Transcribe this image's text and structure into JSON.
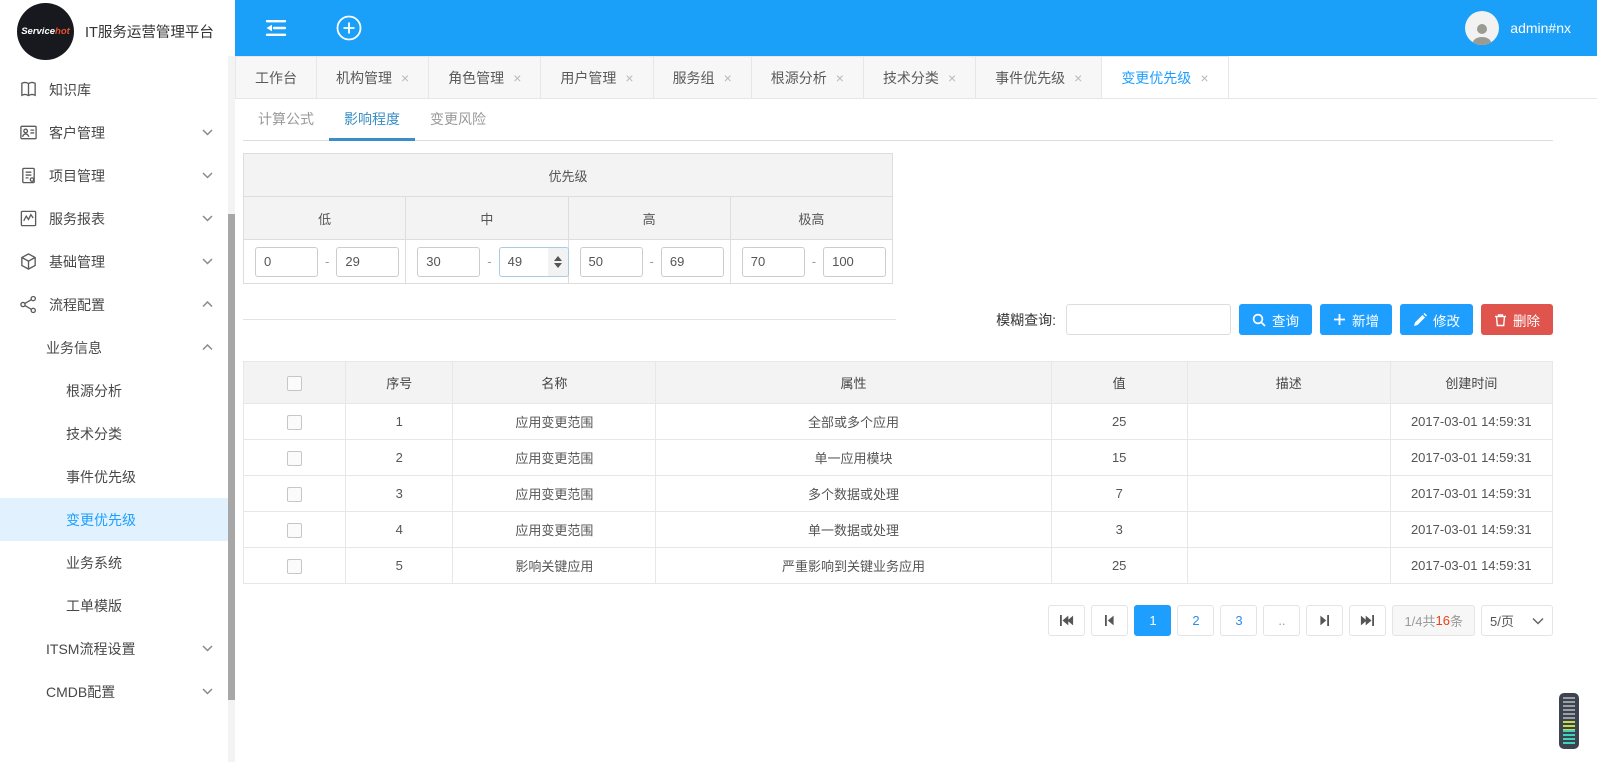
{
  "app": {
    "logo_part1": "Service",
    "logo_part2": "hot",
    "title": "IT服务运营管理平台",
    "username": "admin#nx"
  },
  "colors": {
    "header_blue": "#1aa0f8",
    "accent_blue": "#1E9FFF",
    "subtab_blue": "#3a8ec6",
    "danger_red": "#df544c",
    "count_red": "#ed3f14"
  },
  "icons": [
    "collapse-menu-icon",
    "plus-circle-icon",
    "book-icon",
    "customer-icon",
    "project-icon",
    "report-icon",
    "cube-icon",
    "share-icon",
    "chevron-down-icon",
    "chevron-up-icon",
    "search-icon",
    "plus-icon",
    "pencil-icon",
    "trash-icon",
    "first-page-icon",
    "prev-page-icon",
    "next-page-icon",
    "last-page-icon",
    "avatar"
  ],
  "sidebar": {
    "items": [
      {
        "label": "知识库",
        "icon": "book-icon",
        "level": 1,
        "chevron": ""
      },
      {
        "label": "客户管理",
        "icon": "customer-icon",
        "level": 1,
        "chevron": "down"
      },
      {
        "label": "项目管理",
        "icon": "project-icon",
        "level": 1,
        "chevron": "down"
      },
      {
        "label": "服务报表",
        "icon": "report-icon",
        "level": 1,
        "chevron": "down"
      },
      {
        "label": "基础管理",
        "icon": "cube-icon",
        "level": 1,
        "chevron": "down"
      },
      {
        "label": "流程配置",
        "icon": "share-icon",
        "level": 1,
        "chevron": "up"
      },
      {
        "label": "业务信息",
        "level": 2,
        "chevron": "up"
      },
      {
        "label": "根源分析",
        "level": 3
      },
      {
        "label": "技术分类",
        "level": 3
      },
      {
        "label": "事件优先级",
        "level": 3
      },
      {
        "label": "变更优先级",
        "level": 3,
        "active": true
      },
      {
        "label": "业务系统",
        "level": 3
      },
      {
        "label": "工单模版",
        "level": 3
      },
      {
        "label": "ITSM流程设置",
        "level": 2,
        "chevron": "down"
      },
      {
        "label": "CMDB配置",
        "level": 2,
        "chevron": "down"
      }
    ]
  },
  "tabs": [
    {
      "label": "工作台",
      "closable": false,
      "active": false
    },
    {
      "label": "机构管理",
      "closable": true,
      "active": false
    },
    {
      "label": "角色管理",
      "closable": true,
      "active": false
    },
    {
      "label": "用户管理",
      "closable": true,
      "active": false
    },
    {
      "label": "服务组",
      "closable": true,
      "active": false
    },
    {
      "label": "根源分析",
      "closable": true,
      "active": false
    },
    {
      "label": "技术分类",
      "closable": true,
      "active": false
    },
    {
      "label": "事件优先级",
      "closable": true,
      "active": false
    },
    {
      "label": "变更优先级",
      "closable": true,
      "active": true
    }
  ],
  "close_glyph": "×",
  "subtabs": [
    {
      "label": "计算公式",
      "active": false
    },
    {
      "label": "影响程度",
      "active": true
    },
    {
      "label": "变更风险",
      "active": false
    }
  ],
  "priority": {
    "title": "优先级",
    "levels": [
      {
        "label": "低",
        "min": "0",
        "max": "29"
      },
      {
        "label": "中",
        "min": "30",
        "max": "49"
      },
      {
        "label": "高",
        "min": "50",
        "max": "69"
      },
      {
        "label": "极高",
        "min": "70",
        "max": "100"
      }
    ],
    "separator": "-"
  },
  "search": {
    "label": "模糊查询:",
    "value": "",
    "buttons": [
      {
        "label": "查询",
        "icon": "search-icon",
        "color": "blue"
      },
      {
        "label": "新增",
        "icon": "plus-icon",
        "color": "blue"
      },
      {
        "label": "修改",
        "icon": "pencil-icon",
        "color": "blue"
      },
      {
        "label": "删除",
        "icon": "trash-icon",
        "color": "red"
      }
    ]
  },
  "table": {
    "headers": [
      "序号",
      "名称",
      "属性",
      "值",
      "描述",
      "创建时间"
    ],
    "rows": [
      {
        "idx": "1",
        "name": "应用变更范围",
        "attr": "全部或多个应用",
        "value": "25",
        "desc": "",
        "time": "2017-03-01 14:59:31"
      },
      {
        "idx": "2",
        "name": "应用变更范围",
        "attr": "单一应用模块",
        "value": "15",
        "desc": "",
        "time": "2017-03-01 14:59:31"
      },
      {
        "idx": "3",
        "name": "应用变更范围",
        "attr": "多个数据或处理",
        "value": "7",
        "desc": "",
        "time": "2017-03-01 14:59:31"
      },
      {
        "idx": "4",
        "name": "应用变更范围",
        "attr": "单一数据或处理",
        "value": "3",
        "desc": "",
        "time": "2017-03-01 14:59:31"
      },
      {
        "idx": "5",
        "name": "影响关键应用",
        "attr": "严重影响到关键业务应用",
        "value": "25",
        "desc": "",
        "time": "2017-03-01 14:59:31"
      }
    ]
  },
  "pagination": {
    "pages": [
      "1",
      "2",
      "3",
      ".."
    ],
    "active_page": "1",
    "info_prefix": "1/4共",
    "info_count": "16",
    "info_suffix": "条",
    "per_page": "5/页"
  }
}
